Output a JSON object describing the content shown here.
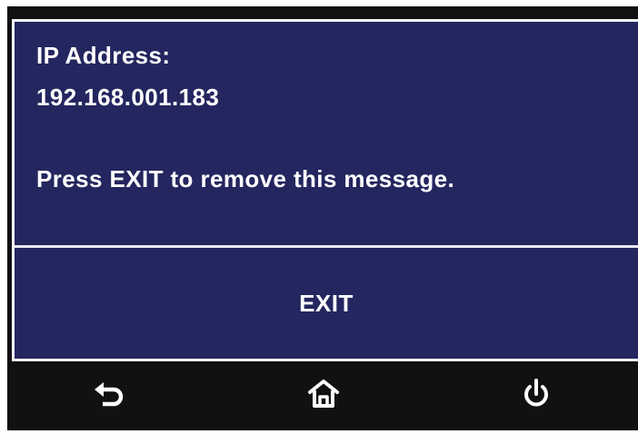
{
  "dialog": {
    "ip_label": "IP Address:",
    "ip_value": "192.168.001.183",
    "instruction": "Press EXIT to remove this message.",
    "exit_label": "EXIT"
  },
  "navbar": {
    "items": [
      {
        "icon": "back-icon"
      },
      {
        "icon": "home-icon"
      },
      {
        "icon": "power-icon"
      }
    ]
  },
  "colors": {
    "dialog_background": "#24265f",
    "dialog_border": "#f4f4f8",
    "navbar_background": "#111114",
    "text": "#ffffff"
  }
}
